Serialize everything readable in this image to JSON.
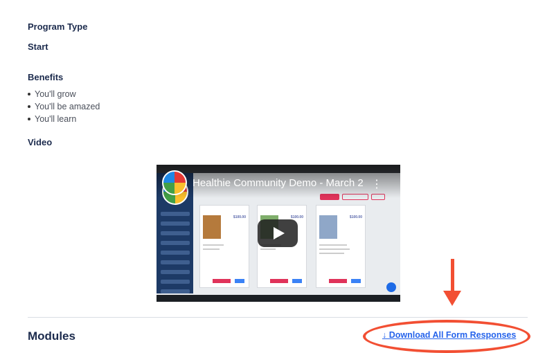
{
  "program_type": {
    "heading": "Program Type",
    "value": "Start"
  },
  "benefits": {
    "heading": "Benefits",
    "items": [
      "You'll grow",
      "You'll be amazed",
      "You'll learn"
    ]
  },
  "video": {
    "heading": "Video",
    "title": "Healthie Community Demo - March 2",
    "menu_glyph": "⋮",
    "prices": [
      "$100.00",
      "$100.00",
      "$100.00"
    ]
  },
  "modules": {
    "heading": "Modules",
    "download_label": "↓ Download All Form Responses"
  },
  "colors": {
    "annotation": "#f24f33",
    "link": "#2563eb",
    "heading": "#1c2b4d"
  }
}
